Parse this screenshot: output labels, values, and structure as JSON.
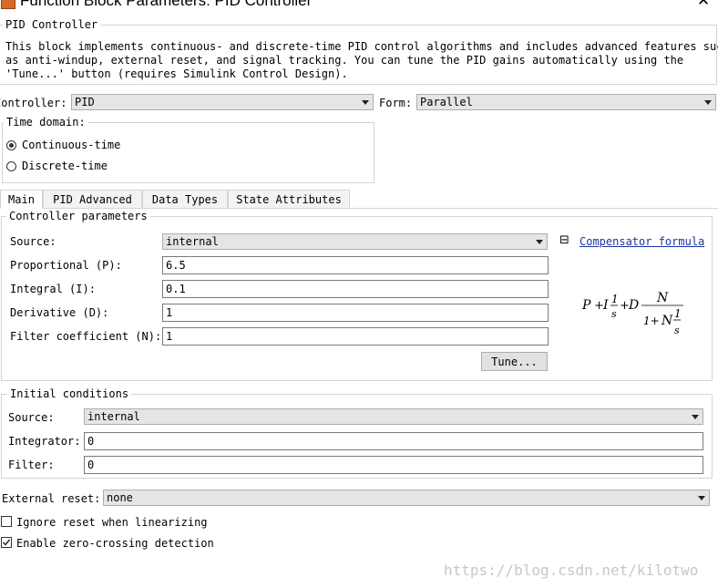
{
  "window": {
    "title": "Function Block Parameters: PID Controller",
    "close_glyph": "✕"
  },
  "block": {
    "name": "PID Controller",
    "description_lines": [
      "This block implements continuous- and discrete-time PID control algorithms and includes advanced features such",
      "as anti-windup, external reset, and signal tracking. You can tune the PID gains automatically using the",
      "'Tune...' button (requires Simulink Control Design)."
    ]
  },
  "controller": {
    "label": "Controller:",
    "value": "PID"
  },
  "form": {
    "label": "Form:",
    "value": "Parallel"
  },
  "time_domain": {
    "label": "Time domain:",
    "options": [
      {
        "label": "Continuous-time",
        "selected": true
      },
      {
        "label": "Discrete-time",
        "selected": false
      }
    ]
  },
  "tabs": [
    {
      "label": "Main",
      "active": true
    },
    {
      "label": "PID Advanced",
      "active": false
    },
    {
      "label": "Data Types",
      "active": false
    },
    {
      "label": "State Attributes",
      "active": false
    }
  ],
  "controller_parameters": {
    "legend": "Controller parameters",
    "source": {
      "label": "Source:",
      "value": "internal"
    },
    "proportional": {
      "label": "Proportional (P):",
      "value": "6.5"
    },
    "integral": {
      "label": "Integral (I):",
      "value": "0.1"
    },
    "derivative": {
      "label": "Derivative (D):",
      "value": "1"
    },
    "filter_coefficient": {
      "label": "Filter coefficient (N):",
      "value": "1"
    },
    "tune_button": "Tune...",
    "compensator_link": "Compensator formula",
    "collapse_glyph": "⊟"
  },
  "initial_conditions": {
    "legend": "Initial conditions",
    "source": {
      "label": "Source:",
      "value": "internal"
    },
    "integrator": {
      "label": "Integrator:",
      "value": "0"
    },
    "filter": {
      "label": "Filter:",
      "value": "0"
    }
  },
  "external_reset": {
    "label": "External reset:",
    "value": "none"
  },
  "options": {
    "ignore_reset": {
      "label": "Ignore reset when linearizing",
      "checked": false
    },
    "zero_crossing": {
      "label": "Enable zero-crossing detection",
      "checked": true
    }
  },
  "watermark": "https://blog.csdn.net/kilotwo",
  "colors": {
    "link": "#1a34a0",
    "combo_bg": "#e5e5e5",
    "border": "#d4d4d4"
  },
  "icons": [
    "app-icon",
    "close-icon",
    "chevron-down-icon",
    "collapse-icon",
    "checkmark-icon"
  ]
}
